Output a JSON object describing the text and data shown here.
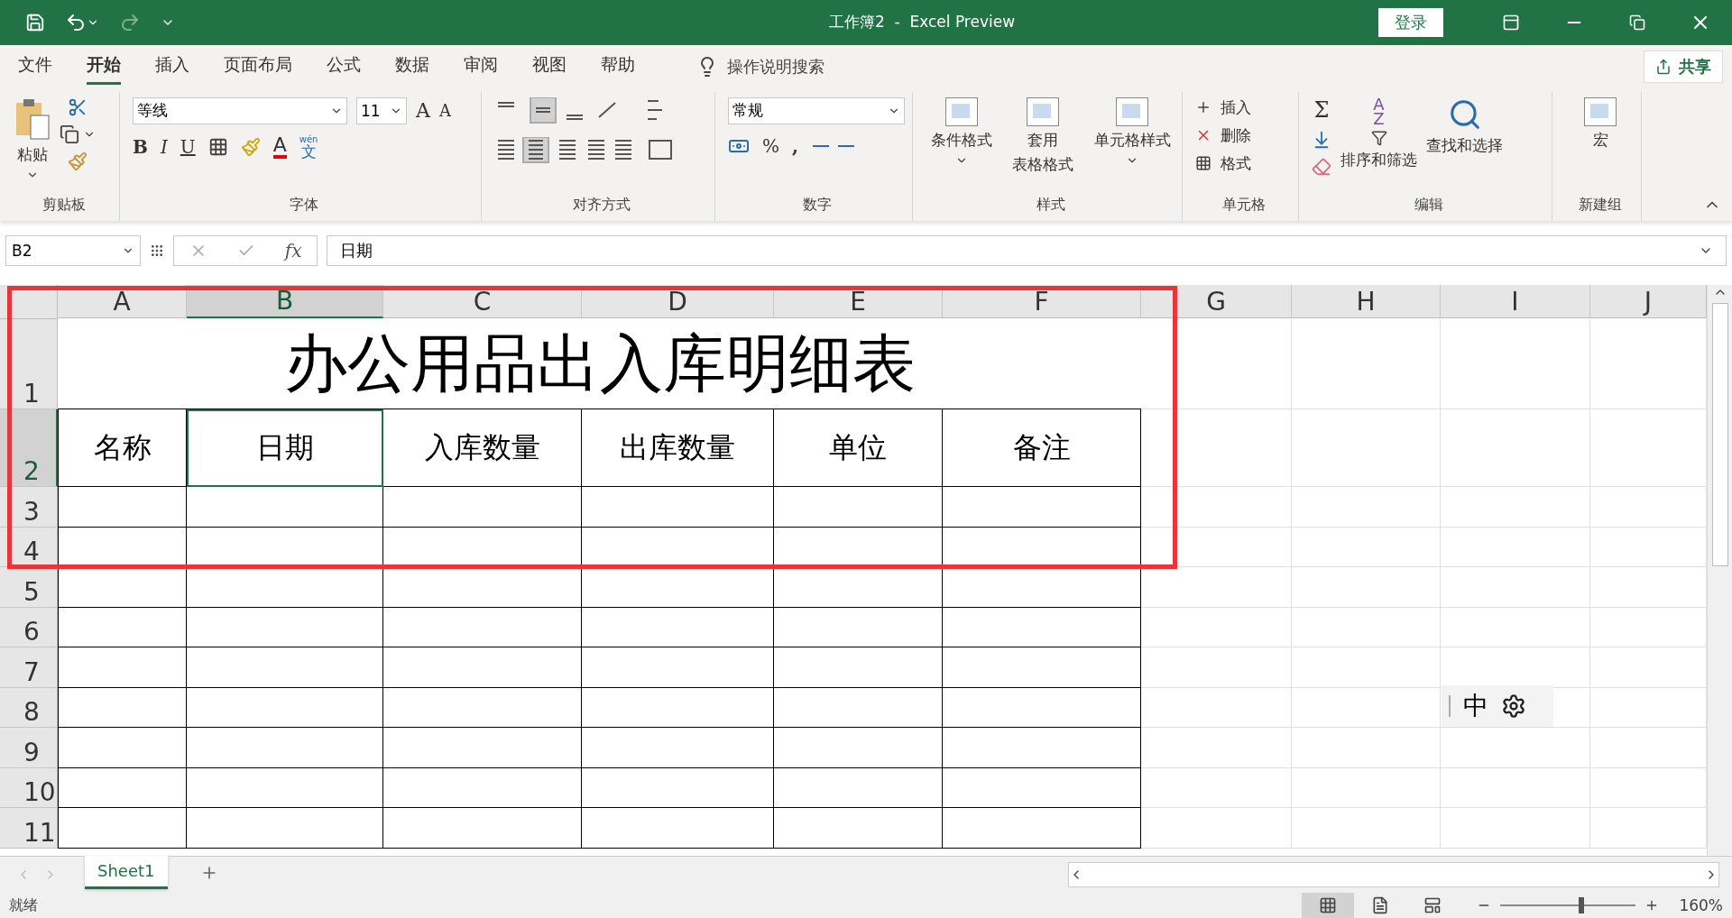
{
  "title_bar": {
    "title": "工作簿2  -  Excel Preview",
    "sign_in": "登录"
  },
  "ribbon_tabs": [
    {
      "label": "文件",
      "selected": false
    },
    {
      "label": "开始",
      "selected": true
    },
    {
      "label": "插入",
      "selected": false
    },
    {
      "label": "页面布局",
      "selected": false
    },
    {
      "label": "公式",
      "selected": false
    },
    {
      "label": "数据",
      "selected": false
    },
    {
      "label": "审阅",
      "selected": false
    },
    {
      "label": "视图",
      "selected": false
    },
    {
      "label": "帮助",
      "selected": false
    }
  ],
  "tell_me": "操作说明搜索",
  "share": "共享",
  "ribbon": {
    "clipboard": {
      "paste": "粘贴",
      "label": "剪贴板"
    },
    "font": {
      "name": "等线",
      "size": "11",
      "grow": "A",
      "shrink": "A",
      "bold": "B",
      "italic": "I",
      "underline": "U",
      "font_color": "A",
      "phonetic_top": "wén",
      "phonetic": "文",
      "label": "字体"
    },
    "alignment": {
      "label": "对齐方式"
    },
    "number": {
      "format": "常规",
      "percent": "%",
      "comma": ",",
      "label": "数字"
    },
    "styles": {
      "conditional": "条件格式",
      "table_1": "套用",
      "table_2": "表格格式",
      "cell_styles": "单元格样式",
      "label": "样式"
    },
    "cells": {
      "insert": "插入",
      "delete": "删除",
      "format": "格式",
      "label": "单元格"
    },
    "editing": {
      "sum": "Σ",
      "sort_a": "A",
      "sort_z": "Z",
      "sort": "排序和筛选",
      "find": "查找和选择",
      "label": "编辑"
    },
    "new_group": {
      "macro": "宏",
      "label": "新建组"
    }
  },
  "formula_bar": {
    "name_box": "B2",
    "fx": "fx",
    "content": "日期"
  },
  "columns": [
    {
      "label": "A",
      "selected": false
    },
    {
      "label": "B",
      "selected": true
    },
    {
      "label": "C",
      "selected": false
    },
    {
      "label": "D",
      "selected": false
    },
    {
      "label": "E",
      "selected": false
    },
    {
      "label": "F",
      "selected": false
    },
    {
      "label": "G",
      "selected": false
    },
    {
      "label": "H",
      "selected": false
    },
    {
      "label": "I",
      "selected": false
    },
    {
      "label": "J",
      "selected": false
    }
  ],
  "rows": [
    {
      "number": "1",
      "selected": false,
      "kind": "title",
      "title": "办公用品出入库明细表"
    },
    {
      "number": "2",
      "selected": true,
      "kind": "header",
      "cells": [
        {
          "text": "名称",
          "selected": false
        },
        {
          "text": "日期",
          "selected": true
        },
        {
          "text": "入库数量",
          "selected": false
        },
        {
          "text": "出库数量",
          "selected": false
        },
        {
          "text": "单位",
          "selected": false
        },
        {
          "text": "备注",
          "selected": false
        }
      ]
    },
    {
      "number": "3",
      "selected": false,
      "kind": "table"
    },
    {
      "number": "4",
      "selected": false,
      "kind": "table"
    },
    {
      "number": "5",
      "selected": false,
      "kind": "table"
    },
    {
      "number": "6",
      "selected": false,
      "kind": "table"
    },
    {
      "number": "7",
      "selected": false,
      "kind": "table"
    },
    {
      "number": "8",
      "selected": false,
      "kind": "table"
    },
    {
      "number": "9",
      "selected": false,
      "kind": "table"
    },
    {
      "number": "10",
      "selected": false,
      "kind": "table"
    },
    {
      "number": "11",
      "selected": false,
      "kind": "table"
    }
  ],
  "ime_toolbar": {
    "mode": "中"
  },
  "sheet_tabs": [
    {
      "label": "Sheet1",
      "selected": true
    }
  ],
  "status_bar": {
    "status": "就绪",
    "zoom": "160%",
    "views": [
      {
        "kind": "normal",
        "selected": true
      },
      {
        "kind": "page_layout",
        "selected": false
      },
      {
        "kind": "page_break",
        "selected": false
      }
    ],
    "zoom_slider": {
      "level": 0.6
    }
  }
}
